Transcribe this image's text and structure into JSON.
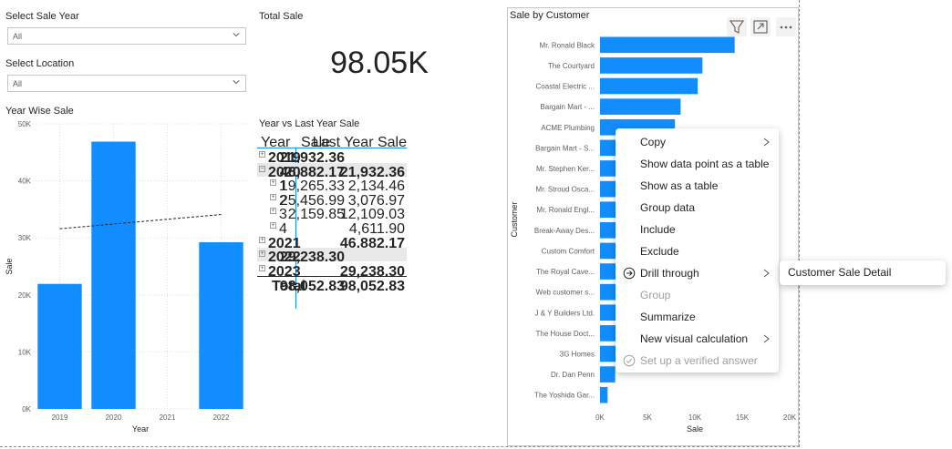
{
  "slicers": [
    {
      "title": "Select Sale Year",
      "value": "All"
    },
    {
      "title": "Select Location",
      "value": "All"
    }
  ],
  "card": {
    "title": "Total Sale",
    "value": "98.05K"
  },
  "year_chart": {
    "title": "Year Wise Sale"
  },
  "matrix": {
    "title": "Year vs Last Year Sale",
    "headers": [
      "Year",
      "Sale",
      "Last Year Sale"
    ],
    "rows": [
      {
        "label": "2019",
        "sale": "21,932.36",
        "last": "",
        "level": 0,
        "bold": true
      },
      {
        "label": "2020",
        "sale": "46,882.17",
        "last": "21,932.36",
        "level": 0,
        "bold": true
      },
      {
        "label": "1",
        "sale": "19,265.33",
        "last": "2,134.46",
        "level": 1,
        "bold": false
      },
      {
        "label": "2",
        "sale": "25,456.99",
        "last": "3,076.97",
        "level": 1,
        "bold": false
      },
      {
        "label": "3",
        "sale": "2,159.85",
        "last": "12,109.03",
        "level": 1,
        "bold": false
      },
      {
        "label": "4",
        "sale": "",
        "last": "4,611.90",
        "level": 1,
        "bold": false
      },
      {
        "label": "2021",
        "sale": "",
        "last": "46,882.17",
        "level": 0,
        "bold": true
      },
      {
        "label": "2022",
        "sale": "29,238.30",
        "last": "",
        "level": 0,
        "bold": true
      },
      {
        "label": "2023",
        "sale": "",
        "last": "29,238.30",
        "level": 0,
        "bold": true
      },
      {
        "label": "Total",
        "sale": "98,052.83",
        "last": "98,052.83",
        "level": -1,
        "bold": true
      }
    ]
  },
  "customer_chart": {
    "title": "Sale by Customer"
  },
  "context_menu": {
    "items": [
      {
        "label": "Copy",
        "arrow": true,
        "disabled": false
      },
      {
        "label": "Show data point as a table",
        "arrow": false,
        "disabled": false
      },
      {
        "label": "Show as a table",
        "arrow": false,
        "disabled": false
      },
      {
        "label": "Group data",
        "arrow": false,
        "disabled": false
      },
      {
        "label": "Include",
        "arrow": false,
        "disabled": false
      },
      {
        "label": "Exclude",
        "arrow": false,
        "disabled": false
      },
      {
        "label": "Drill through",
        "arrow": true,
        "disabled": false,
        "icon": "drill-through-icon"
      },
      {
        "label": "Group",
        "arrow": false,
        "disabled": true
      },
      {
        "label": "Summarize",
        "arrow": false,
        "disabled": false
      },
      {
        "label": "New visual calculation",
        "arrow": true,
        "disabled": false
      },
      {
        "label": "Set up a verified answer",
        "arrow": false,
        "disabled": true,
        "icon": "verified-check-icon"
      }
    ],
    "submenu": {
      "label": "Customer Sale Detail"
    }
  },
  "icons": {
    "filter": "filter-icon",
    "focus": "focus-mode-icon",
    "more": "more-options-icon"
  },
  "colors": {
    "bar": "#118dff",
    "trend": "#252423",
    "grid": "#e1dfdd",
    "accent": "#118dff"
  },
  "chart_data": [
    {
      "type": "bar",
      "title": "Year Wise Sale",
      "xlabel": "Year",
      "ylabel": "Sale",
      "categories": [
        "2019",
        "2020",
        "2021",
        "2022"
      ],
      "values": [
        21932.36,
        46882.17,
        0,
        29238.3
      ],
      "ylim": [
        0,
        50000
      ],
      "yticks": [
        0,
        10000,
        20000,
        30000,
        40000,
        50000
      ],
      "ytick_labels": [
        "0K",
        "10K",
        "20K",
        "30K",
        "40K",
        "50K"
      ],
      "trend_line": [
        31600,
        34100
      ],
      "grid": true
    },
    {
      "type": "bar",
      "orientation": "horizontal",
      "title": "Sale by Customer",
      "xlabel": "Sale",
      "ylabel": "Customer",
      "categories": [
        "Mr. Ronald Black",
        "The Courtyard",
        "Coastal Electric ...",
        "Bargain Mart - ...",
        "ACME Plumbing",
        "Bargain Mart - S...",
        "Mr. Stephen Ker...",
        "Mr. Stroud Osca...",
        "Mr. Ronald Engl...",
        "Break-Away Des...",
        "Custom Comfort",
        "The Royal Cave...",
        "Web customer s...",
        "J & Y Builders Ltd.",
        "The House Doct...",
        "3G Homes",
        "Dr. Dan Penn",
        "The Yoshida Gar..."
      ],
      "values": [
        14200,
        10800,
        10300,
        8500,
        7900,
        7000,
        6300,
        5800,
        5300,
        4800,
        4400,
        3900,
        3500,
        3000,
        2500,
        2100,
        1600,
        800
      ],
      "xlim": [
        0,
        20000
      ],
      "xticks": [
        0,
        5000,
        10000,
        15000,
        20000
      ],
      "xtick_labels": [
        "0K",
        "5K",
        "10K",
        "15K",
        "20K"
      ],
      "grid": false
    }
  ]
}
